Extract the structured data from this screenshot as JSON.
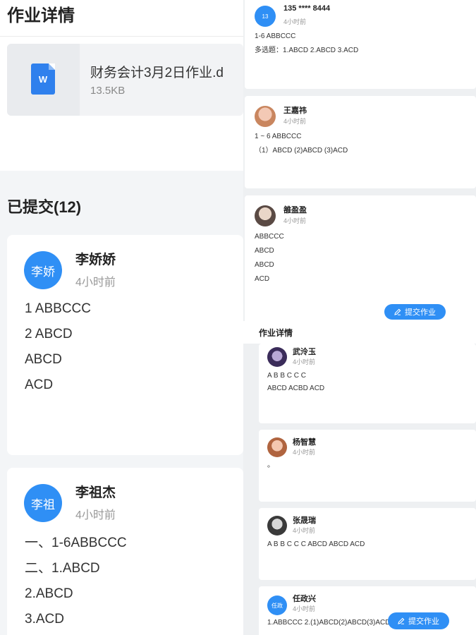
{
  "colors": {
    "accent": "#2f8ff5"
  },
  "left": {
    "title": "作业详情",
    "file": {
      "icon": "word-icon",
      "icon_letter": "W",
      "name": "财务会计3月2日作业.d",
      "size": "13.5KB"
    },
    "submitted_title": "已提交(12)",
    "cards": [
      {
        "avatar": "李娇",
        "name": "李娇娇",
        "time": "4小时前",
        "lines": [
          "1 ABBCCC",
          "2 ABCD",
          "ABCD",
          "ACD"
        ]
      },
      {
        "avatar": "李祖",
        "name": "李祖杰",
        "time": "4小时前",
        "lines": [
          "一、1-6ABBCCC",
          "二、1.ABCD",
          "2.ABCD",
          "3.ACD"
        ]
      }
    ]
  },
  "right_upper": {
    "cards": [
      {
        "avatar": "13",
        "name": "135 **** 8444",
        "time": "4小时前",
        "lines": [
          "1-6 ABBCCC",
          "多选题：1.ABCD 2.ABCD 3.ACD"
        ]
      },
      {
        "avatar": "",
        "name": "王嘉祎",
        "time": "4小时前",
        "lines": [
          "1 ~ 6 ABBCCC",
          "（1）ABCD (2)ABCD (3)ACD"
        ]
      },
      {
        "avatar": "",
        "name": "雒盈盈",
        "time": "4小时前",
        "lines": [
          "ABBCCC",
          "ABCD",
          "ABCD",
          "ACD"
        ]
      }
    ],
    "submit_label": "提交作业"
  },
  "right_lower": {
    "title": "作业详情",
    "cards": [
      {
        "avatar": "",
        "name": "武泠玉",
        "time": "4小时前",
        "lines": [
          "A B B C C C",
          "ABCD ACBD ACD"
        ]
      },
      {
        "avatar": "",
        "name": "杨智慧",
        "time": "4小时前",
        "lines": [
          "。"
        ]
      },
      {
        "avatar": "",
        "name": "张晟瑞",
        "time": "4小时前",
        "lines": [
          "A B B C C C ABCD ABCD ACD"
        ]
      },
      {
        "avatar": "任政",
        "name": "任政兴",
        "time": "4小时前",
        "lines": [
          "1.ABBCCC 2.(1)ABCD(2)ABCD(3)ACD"
        ]
      }
    ],
    "submit_label": "提交作业"
  }
}
